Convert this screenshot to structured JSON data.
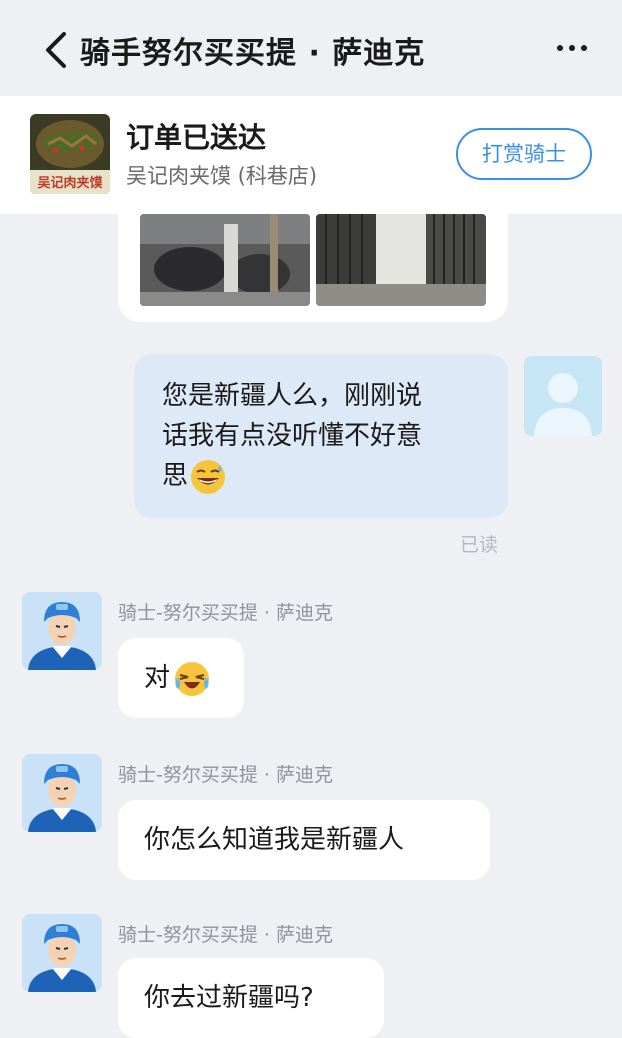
{
  "nav": {
    "back_icon": "chevron-left-icon",
    "title": "骑手努尔买买提 · 萨迪克",
    "more_icon": "more-dots-icon"
  },
  "order": {
    "status": "订单已送达",
    "store": "吴记肉夹馍 (科巷店)",
    "store_logo_text": "吴记肉夹馍",
    "tip_button": "打赏骑士"
  },
  "messages": [
    {
      "sender": "me",
      "text": "您是新疆人么，刚刚说话我有点没听懂不好意思",
      "line1": "您是新疆人么，刚刚说",
      "line2": "话我有点没听懂不好意",
      "line3": "思",
      "emoji": "grinning-sweat-emoji",
      "receipt": "已读"
    },
    {
      "sender": "rider",
      "name": "骑士-努尔买买提 · 萨迪克",
      "text": "对",
      "emoji": "laughing-crying-emoji"
    },
    {
      "sender": "rider",
      "name": "骑士-努尔买买提 · 萨迪克",
      "text": "你怎么知道我是新疆人"
    },
    {
      "sender": "rider",
      "name": "骑士-努尔买买提 · 萨迪克",
      "text": "你去过新疆吗?"
    }
  ],
  "colors": {
    "accent": "#3a8fe8",
    "background": "#eef0f4",
    "my_bubble": "#dde9f7",
    "rider_bubble": "#ffffff"
  }
}
